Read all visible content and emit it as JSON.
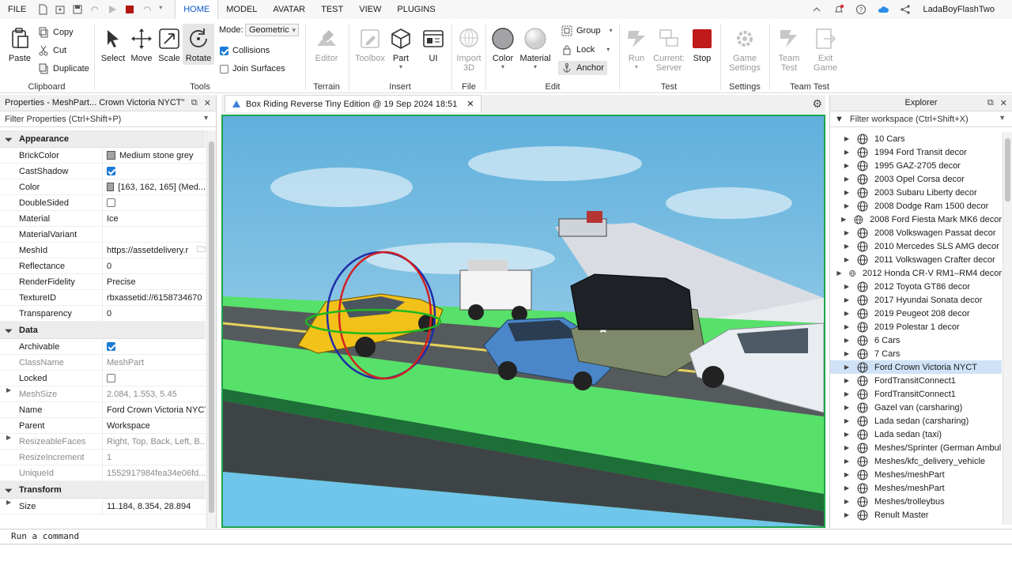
{
  "menubar": {
    "file": "FILE",
    "tabs": [
      {
        "label": "HOME",
        "active": true
      },
      {
        "label": "MODEL",
        "active": false
      },
      {
        "label": "AVATAR",
        "active": false
      },
      {
        "label": "TEST",
        "active": false
      },
      {
        "label": "VIEW",
        "active": false
      },
      {
        "label": "PLUGINS",
        "active": false
      }
    ],
    "username": "LadaBoyFlashTwo"
  },
  "ribbon": {
    "clipboard": {
      "paste": "Paste",
      "copy": "Copy",
      "cut": "Cut",
      "duplicate": "Duplicate",
      "title": "Clipboard"
    },
    "tools": {
      "select": "Select",
      "move": "Move",
      "scale": "Scale",
      "rotate": "Rotate",
      "title": "Tools",
      "mode_label": "Mode:",
      "mode_value": "Geometric",
      "collisions": "Collisions",
      "collisions_on": true,
      "join_surfaces": "Join Surfaces",
      "join_on": false
    },
    "terrain": {
      "editor": "Editor",
      "title": "Terrain"
    },
    "insert": {
      "toolbox": "Toolbox",
      "part": "Part",
      "ui": "UI",
      "title": "Insert"
    },
    "file": {
      "import3d_1": "Import",
      "import3d_2": "3D",
      "title": "File"
    },
    "edit": {
      "color": "Color",
      "material": "Material",
      "group": "Group",
      "lock": "Lock",
      "anchor": "Anchor",
      "title": "Edit"
    },
    "test": {
      "run": "Run",
      "current_1": "Current:",
      "current_2": "Server",
      "stop": "Stop",
      "title": "Test"
    },
    "settings": {
      "game_1": "Game",
      "game_2": "Settings",
      "title": "Settings"
    },
    "teamtest": {
      "team_1": "Team",
      "team_2": "Test",
      "exit_1": "Exit",
      "exit_2": "Game",
      "title": "Team Test"
    }
  },
  "properties": {
    "title": "Properties - MeshPart... Crown Victoria NYCT\"",
    "filter": "Filter Properties (Ctrl+Shift+P)",
    "sections": {
      "appearance": "Appearance",
      "data": "Data",
      "transform": "Transform"
    },
    "rows": {
      "brickcolor": {
        "name": "BrickColor",
        "value": "Medium stone grey"
      },
      "castshadow": {
        "name": "CastShadow"
      },
      "color": {
        "name": "Color",
        "value": "[163, 162, 165] (Med..."
      },
      "doublesided": {
        "name": "DoubleSided"
      },
      "material": {
        "name": "Material",
        "value": "Ice"
      },
      "materialvariant": {
        "name": "MaterialVariant",
        "value": ""
      },
      "meshid": {
        "name": "MeshId",
        "value": "https://assetdelivery.r"
      },
      "reflectance": {
        "name": "Reflectance",
        "value": "0"
      },
      "renderfidelity": {
        "name": "RenderFidelity",
        "value": "Precise"
      },
      "textureid": {
        "name": "TextureID",
        "value": "rbxassetid://6158734670"
      },
      "transparency": {
        "name": "Transparency",
        "value": "0"
      },
      "archivable": {
        "name": "Archivable"
      },
      "classname": {
        "name": "ClassName",
        "value": "MeshPart"
      },
      "locked": {
        "name": "Locked"
      },
      "meshsize": {
        "name": "MeshSize",
        "value": "2.084, 1.553, 5.45"
      },
      "name": {
        "name": "Name",
        "value": "Ford Crown Victoria NYCT"
      },
      "parent": {
        "name": "Parent",
        "value": "Workspace"
      },
      "resizeablefaces": {
        "name": "ResizeableFaces",
        "value": "Right, Top, Back, Left, B..."
      },
      "resizeincrement": {
        "name": "ResizeIncrement",
        "value": "1"
      },
      "uniqueid": {
        "name": "UniqueId",
        "value": "1552917984fea34e06fd..."
      },
      "size": {
        "name": "Size",
        "value": "11.184, 8.354, 28.894"
      }
    }
  },
  "viewport": {
    "tab_title": "Box Riding Reverse Tiny Edition @ 19 Sep 2024 18:51"
  },
  "explorer": {
    "title": "Explorer",
    "filter": "Filter workspace (Ctrl+Shift+X)",
    "items": [
      "10 Cars",
      "1994 Ford Transit decor",
      "1995 GAZ-2705 decor",
      "2003 Opel Corsa decor",
      "2003 Subaru Liberty decor",
      "2008 Dodge Ram 1500 decor",
      "2008 Ford Fiesta Mark MK6 decor",
      "2008 Volkswagen Passat decor",
      "2010 Mercedes SLS AMG decor",
      "2011 Volkswagen Crafter decor",
      "2012 Honda CR-V RM1–RM4 decor",
      "2012 Toyota GT86 decor",
      "2017 Hyundai Sonata decor",
      "2019 Peugeot 208 decor",
      "2019 Polestar 1 decor",
      "6 Cars",
      "7 Cars",
      "Ford Crown Victoria NYCT",
      "FordTransitConnect1",
      "FordTransitConnect1",
      "Gazel van (carsharing)",
      "Lada sedan (carsharing)",
      "Lada sedan (taxi)",
      "Meshes/Sprinter (German Ambul",
      "Meshes/kfc_delivery_vehicle",
      "Meshes/meshPart",
      "Meshes/meshPart",
      "Meshes/trolleybus",
      "Renult Master"
    ],
    "selected_index": 17
  },
  "command": {
    "placeholder": "Run a command"
  },
  "colors": {
    "accent": "#0a58c7",
    "selection": "#cfe2f7",
    "viewport_border": "#1fa34a",
    "stop_red": "#c11a1a"
  }
}
